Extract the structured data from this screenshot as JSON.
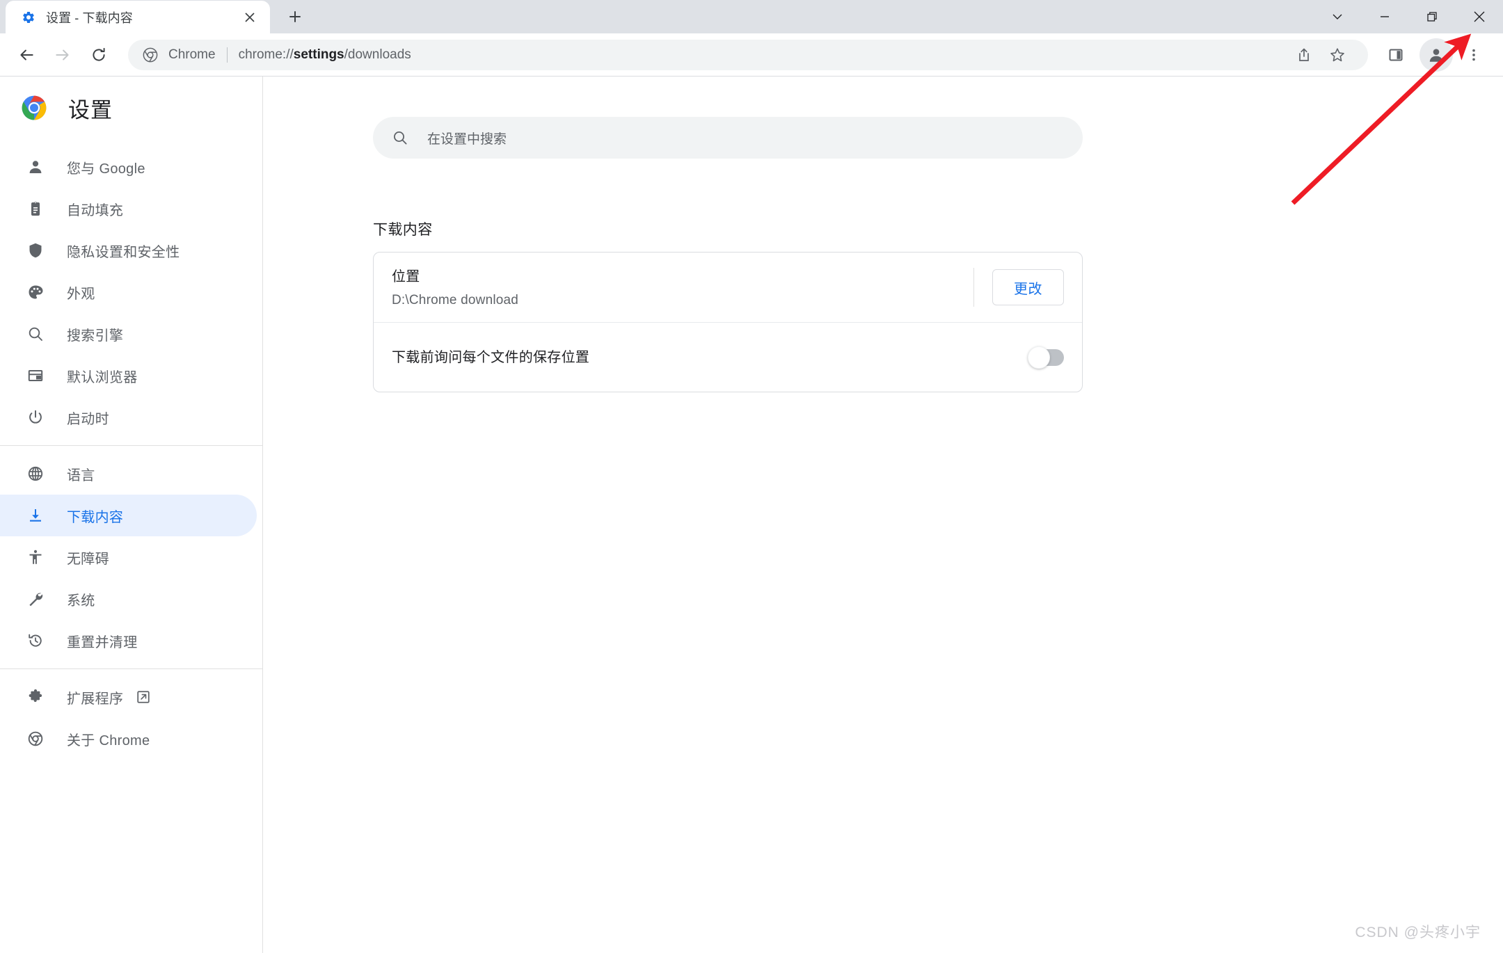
{
  "window": {
    "controls": [
      {
        "name": "tab-search",
        "glyph": "chevron-down"
      },
      {
        "name": "minimize",
        "glyph": "minimize"
      },
      {
        "name": "restore",
        "glyph": "restore"
      },
      {
        "name": "close",
        "glyph": "close"
      }
    ]
  },
  "tab": {
    "title": "设置 - 下载内容",
    "favicon": "settings-gear-icon",
    "close_label": "×",
    "newtab_label": "+"
  },
  "toolbar": {
    "back": "back-arrow-icon",
    "forward": "forward-arrow-icon",
    "reload": "reload-icon",
    "omnibox": {
      "chip_icon": "chrome-logo-icon",
      "chip_label": "Chrome",
      "url_prefix": "chrome://",
      "url_bold": "settings",
      "url_suffix": "/downloads"
    },
    "share": "share-icon",
    "bookmark": "star-icon",
    "side_panel": "side-panel-icon",
    "profile": "avatar-icon",
    "menu": "three-dot-menu-icon"
  },
  "sidebar": {
    "brand": {
      "logo": "chrome-logo-icon",
      "title": "设置"
    },
    "groups": [
      {
        "items": [
          {
            "label": "您与 Google",
            "icon": "person-icon",
            "selected": false
          },
          {
            "label": "自动填充",
            "icon": "clipboard-icon",
            "selected": false
          },
          {
            "label": "隐私设置和安全性",
            "icon": "shield-icon",
            "selected": false
          },
          {
            "label": "外观",
            "icon": "palette-icon",
            "selected": false
          },
          {
            "label": "搜索引擎",
            "icon": "search-icon",
            "selected": false
          },
          {
            "label": "默认浏览器",
            "icon": "browser-window-icon",
            "selected": false
          },
          {
            "label": "启动时",
            "icon": "power-icon",
            "selected": false
          }
        ]
      },
      {
        "items": [
          {
            "label": "语言",
            "icon": "globe-icon",
            "selected": false
          },
          {
            "label": "下载内容",
            "icon": "download-icon",
            "selected": true
          },
          {
            "label": "无障碍",
            "icon": "accessibility-icon",
            "selected": false
          },
          {
            "label": "系统",
            "icon": "wrench-icon",
            "selected": false
          },
          {
            "label": "重置并清理",
            "icon": "history-restore-icon",
            "selected": false
          }
        ]
      },
      {
        "items": [
          {
            "label": "扩展程序",
            "icon": "puzzle-icon",
            "selected": false,
            "external": true
          },
          {
            "label": "关于 Chrome",
            "icon": "chrome-outline-icon",
            "selected": false
          }
        ]
      }
    ]
  },
  "main": {
    "search": {
      "icon": "search-icon",
      "placeholder": "在设置中搜索",
      "value": ""
    },
    "section_title": "下载内容",
    "rows": [
      {
        "label": "位置",
        "sub": "D:\\Chrome download",
        "action_label": "更改",
        "control": "button"
      },
      {
        "label": "下载前询问每个文件的保存位置",
        "sub": "",
        "control": "toggle",
        "toggle_on": false
      }
    ]
  },
  "annotation": {
    "type": "arrow",
    "color": "#ee1c25",
    "points_to": "window-close-button"
  },
  "watermark": "CSDN @头疼小宇",
  "colors": {
    "accent": "#1a73e8",
    "selected_bg": "#e8f0fe",
    "tabstrip_bg": "#dee1e6",
    "omnibox_bg": "#f1f3f4"
  }
}
